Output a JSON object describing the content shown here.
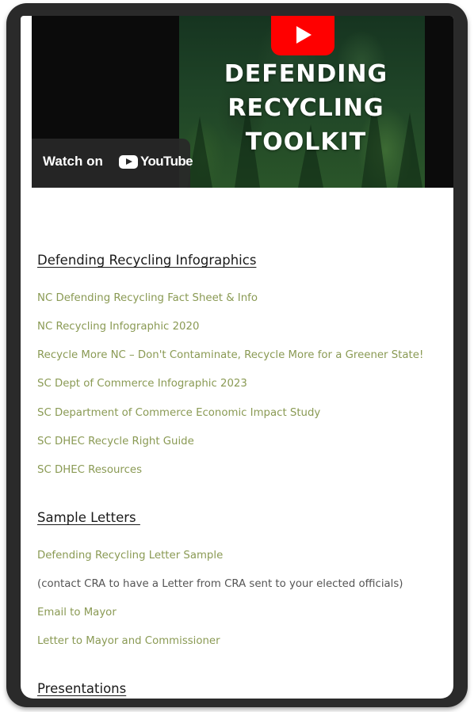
{
  "video": {
    "title_lines": [
      "DEFENDING",
      "RECYCLING",
      "TOOLKIT"
    ],
    "watch_on_label": "Watch on",
    "youtube_logo_text": "YouTube",
    "brand_color": "#ff0000"
  },
  "infographics": {
    "heading": "Defending Recycling Infographics",
    "links": [
      "NC Defending Recycling Fact Sheet & Info",
      "NC Recycling Infographic 2020",
      "Recycle More NC – Don't Contaminate, Recycle More for a Greener State!",
      "SC Dept of Commerce Infographic 2023",
      "SC Department of Commerce Economic Impact Study",
      "SC DHEC Recycle Right Guide",
      "SC DHEC Resources"
    ]
  },
  "sample_letters": {
    "heading": "Sample Letters ",
    "items": [
      "Defending Recycling Letter Sample",
      "(contact CRA to have a Letter from CRA sent to your elected officials)",
      "Email to Mayor",
      "Letter to Mayor and Commissioner"
    ]
  },
  "presentations": {
    "heading": "Presentations"
  },
  "colors": {
    "link": "#8a9a54",
    "heading": "#1a1a1a",
    "frame": "#2a2a2a"
  }
}
